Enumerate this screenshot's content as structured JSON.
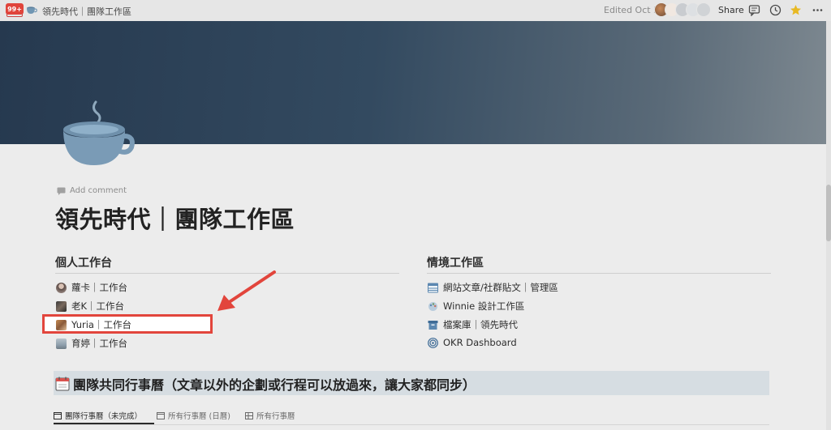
{
  "topbar": {
    "badge": "99+",
    "page_title": "領先時代｜團隊工作區",
    "edited": "Edited Oct 3",
    "share_label": "Share"
  },
  "page": {
    "add_comment": "Add comment",
    "title": "領先時代｜團隊工作區"
  },
  "personal": {
    "heading": "個人工作台",
    "items": [
      {
        "label": "蘿卡｜工作台"
      },
      {
        "label": "老K｜工作台"
      },
      {
        "label": "Yuria｜工作台"
      },
      {
        "label": "育婷｜工作台"
      }
    ]
  },
  "context": {
    "heading": "情境工作區",
    "items": [
      {
        "label": "網站文章/社群貼文｜管理區"
      },
      {
        "label": "Winnie 設計工作區"
      },
      {
        "label": "檔案庫｜領先時代"
      },
      {
        "label": "OKR Dashboard"
      }
    ]
  },
  "calendar": {
    "title": "團隊共同行事曆（文章以外的企劃或行程可以放過來，讓大家都同步）",
    "tabs": [
      {
        "label": "團隊行事曆（未完成）"
      },
      {
        "label": "所有行事曆 (日曆)"
      },
      {
        "label": "所有行事曆"
      }
    ]
  },
  "colors": {
    "highlight_border": "#e2453c",
    "arrow": "#e2453c",
    "badge": "#e0443b"
  }
}
